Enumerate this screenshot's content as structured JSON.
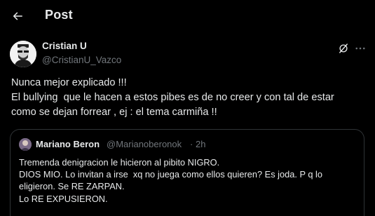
{
  "header": {
    "title": "Post",
    "back_icon": "arrow-left-icon"
  },
  "post": {
    "author": {
      "display_name": "Cristian U",
      "handle": "@CristianU_Vazco",
      "avatar": "avatar-image"
    },
    "actions": {
      "grok_icon": "grok-icon",
      "more_icon": "more-horizontal-icon"
    },
    "text_lines": [
      "Nunca mejor explicado !!!",
      "El bullying  que le hacen a estos pibes es de no creer y con tal de estar",
      "como se dejan forrear , ej : el tema carmiña !!"
    ]
  },
  "quote": {
    "author": {
      "display_name": "Mariano Beron",
      "handle": "@Marianoberonok",
      "separator": "·",
      "time": "2h"
    },
    "text_lines": [
      "Tremenda denigracion le hicieron al pibito NIGRO.",
      "DIOS MIO. Lo invitan a irse  xq no juega como ellos quieren? Es joda. P q lo",
      "eligieron. Se RE ZARPAN.",
      "Lo RE EXPUSIERON."
    ]
  },
  "colors": {
    "background": "#000000",
    "primary_text": "#e7e9ea",
    "secondary_text": "#71767b",
    "border": "#2f3336"
  }
}
